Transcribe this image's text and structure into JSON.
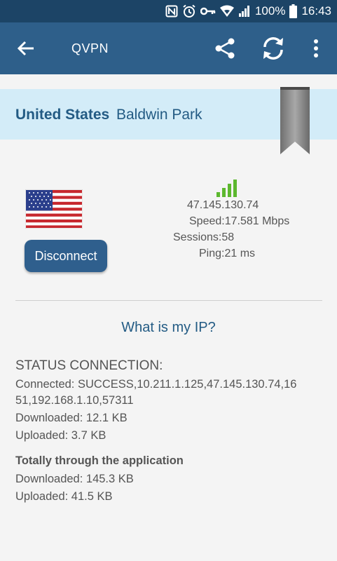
{
  "status_bar": {
    "battery": "100%",
    "time": "16:43",
    "icons": [
      "nfc-icon",
      "alarm-icon",
      "vpn-key-icon",
      "wifi-icon",
      "cell-signal-icon",
      "battery-icon"
    ]
  },
  "app_bar": {
    "title": "QVPN",
    "icons": [
      "back-arrow-icon",
      "share-icon",
      "refresh-icon",
      "more-vert-icon"
    ]
  },
  "location": {
    "country": "United States",
    "city": "Baldwin Park"
  },
  "server": {
    "ip": "47.145.130.74",
    "speed": "Speed:17.581 Mbps",
    "sessions": "Sessions:58",
    "ping": "Ping:21 ms",
    "signal_bars": 4,
    "signal_color": "#5cb82e"
  },
  "disconnect_label": "Disconnect",
  "what_is_my_ip": "What is my IP?",
  "status": {
    "heading": "STATUS CONNECTION:",
    "connected_line1": "Connected: SUCCESS,10.211.1.125,47.145.130.74,16",
    "connected_line2": "51,192.168.1.10,57311",
    "downloaded": "Downloaded: 12.1 KB",
    "uploaded": "Uploaded: 3.7 KB"
  },
  "totals": {
    "heading": "Totally through the application",
    "downloaded": "Downloaded: 145.3 KB",
    "uploaded": "Uploaded: 41.5 KB"
  },
  "colors": {
    "status_bar": "#1c4466",
    "app_bar": "#2e5f8a",
    "banner": "#d3ecf8",
    "accent_text": "#235b84",
    "button": "#2f5f8d"
  }
}
